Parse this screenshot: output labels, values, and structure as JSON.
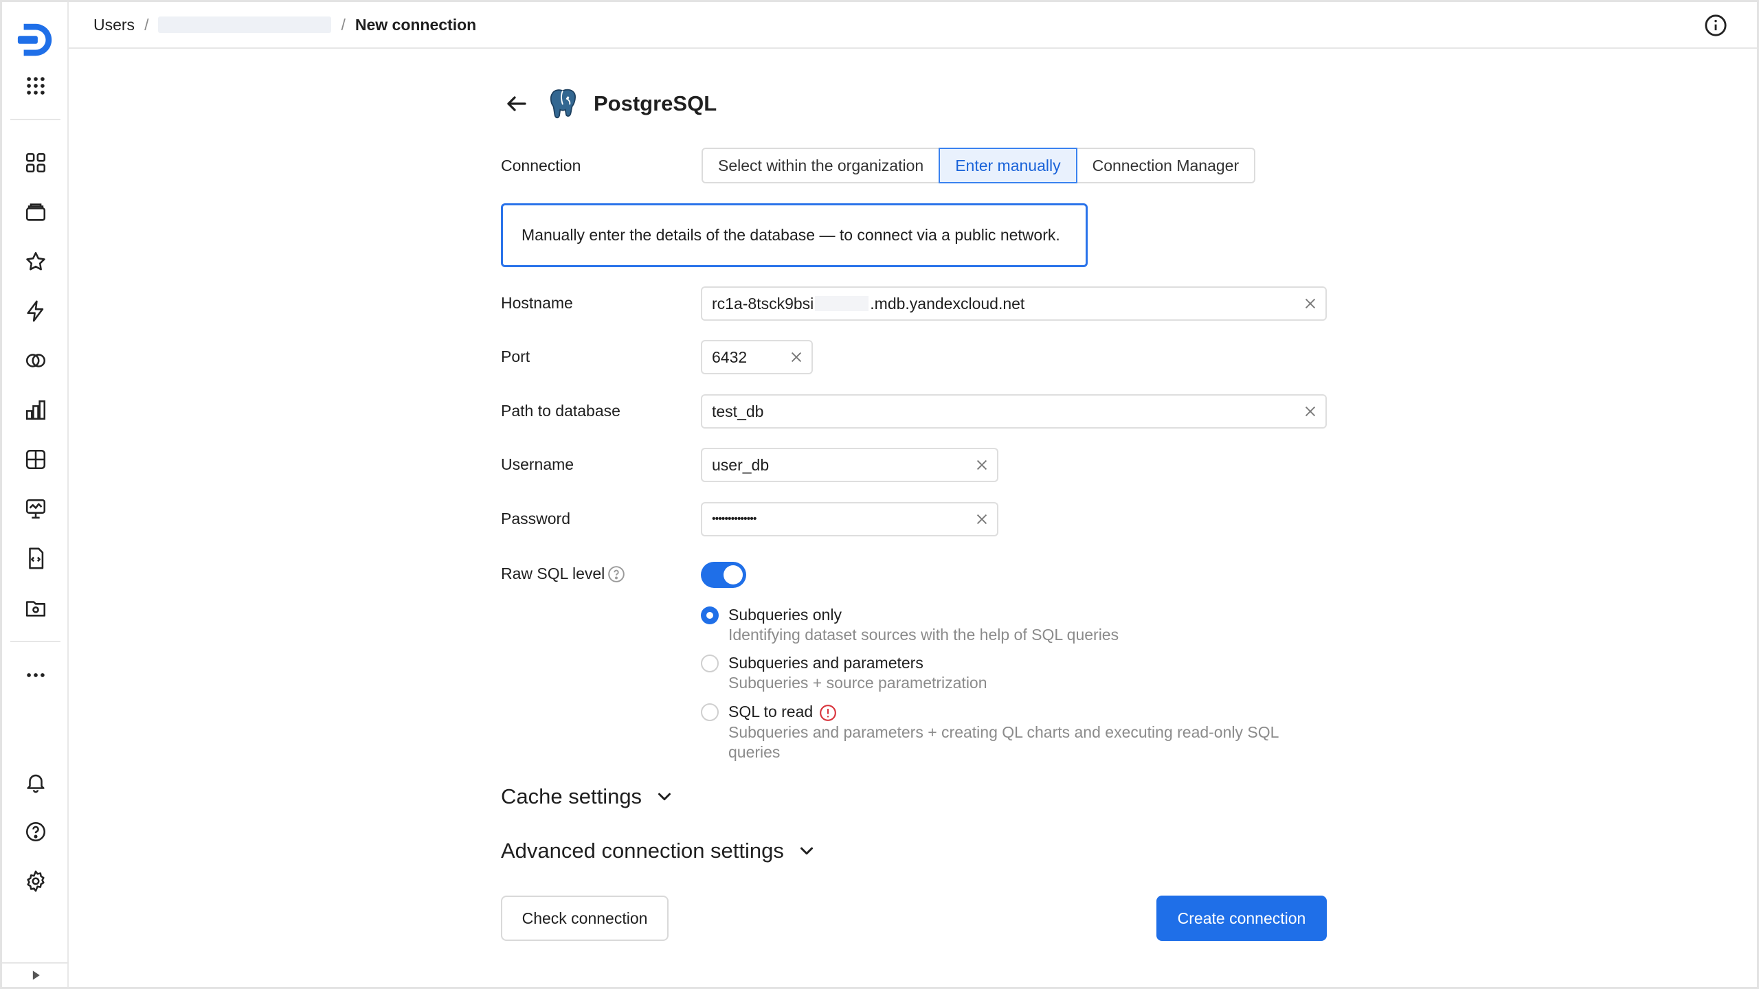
{
  "breadcrumb": {
    "root": "Users",
    "separator": "/",
    "current": "New connection"
  },
  "connector": {
    "title": "PostgreSQL"
  },
  "connection": {
    "label": "Connection",
    "options": [
      "Select within the organization",
      "Enter manually",
      "Connection Manager"
    ],
    "selected": "Enter manually",
    "notice": "Manually enter the details of the database — to connect via a public network."
  },
  "fields": {
    "hostname": {
      "label": "Hostname",
      "value_prefix": "rc1a-8tsck9bsi",
      "value_suffix": ".mdb.yandexcloud.net"
    },
    "port": {
      "label": "Port",
      "value": "6432"
    },
    "path": {
      "label": "Path to database",
      "value": "test_db"
    },
    "username": {
      "label": "Username",
      "value": "user_db"
    },
    "password": {
      "label": "Password",
      "value": "••••••••••••••"
    }
  },
  "raw_sql": {
    "label": "Raw SQL level",
    "enabled": true,
    "options": [
      {
        "title": "Subqueries only",
        "desc": "Identifying dataset sources with the help of SQL queries",
        "checked": true
      },
      {
        "title": "Subqueries and parameters",
        "desc": "Subqueries + source parametrization",
        "checked": false
      },
      {
        "title": "SQL to read",
        "desc": "Subqueries and parameters + creating QL charts and executing read-only SQL queries",
        "checked": false
      }
    ]
  },
  "sections": {
    "cache": "Cache settings",
    "advanced": "Advanced connection settings"
  },
  "buttons": {
    "check": "Check connection",
    "create": "Create connection"
  },
  "colors": {
    "accent": "#1f6fe8",
    "warning": "#d9363e"
  }
}
